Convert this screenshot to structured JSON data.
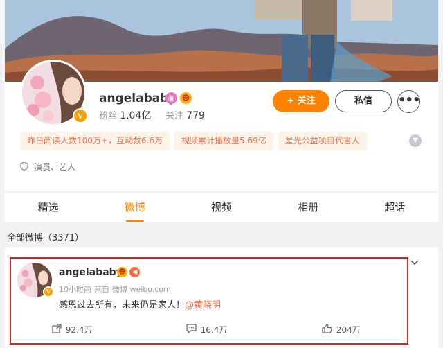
{
  "profile": {
    "name": "angelababy",
    "fans_label": "粉丝",
    "fans_value": "1.04亿",
    "following_label": "关注",
    "following_value": "779",
    "follow_button": "+ 关注",
    "message_button": "私信",
    "more_button": "•••",
    "tags": [
      "昨日阅读人数100万+，互动数6.6万",
      "视频累计播放量5.69亿",
      "星光公益项目代言人"
    ],
    "identity": "演员、艺人",
    "verified_mark": "V"
  },
  "tabs": [
    "精选",
    "微博",
    "视频",
    "相册",
    "超话"
  ],
  "active_tab": "微博",
  "posts_count_line": "全部微博（3371）",
  "post": {
    "author": "angelababy",
    "time": "10小时前",
    "source_prefix": "来自",
    "source": "微博 weibo.com",
    "text": "感恩过去所有，未来仍是家人！",
    "mention": "@黄晓明",
    "reposts": "92.4万",
    "comments": "16.4万",
    "likes": "204万"
  },
  "colors": {
    "accent": "#ff8200",
    "tag_bg": "#fff2e6",
    "tag_text": "#eb7350",
    "highlight_border": "#e02020"
  }
}
